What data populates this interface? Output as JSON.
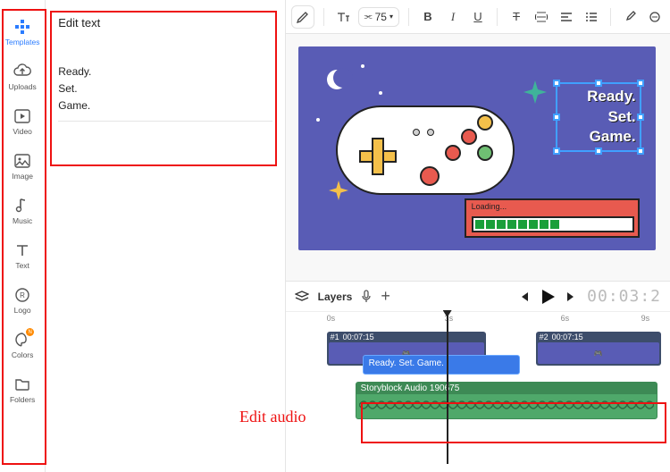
{
  "sidebar": {
    "items": [
      {
        "label": "Templates",
        "icon": "templates-icon"
      },
      {
        "label": "Uploads",
        "icon": "uploads-icon"
      },
      {
        "label": "Video",
        "icon": "video-icon"
      },
      {
        "label": "Image",
        "icon": "image-icon"
      },
      {
        "label": "Music",
        "icon": "music-icon"
      },
      {
        "label": "Text",
        "icon": "text-icon"
      },
      {
        "label": "Logo",
        "icon": "logo-icon"
      },
      {
        "label": "Colors",
        "icon": "colors-icon",
        "badge": "N"
      },
      {
        "label": "Folders",
        "icon": "folders-icon"
      }
    ]
  },
  "panel": {
    "title": "Edit text",
    "content": "Ready.\nSet.\nGame."
  },
  "toolbar": {
    "font_size": "75",
    "bold": "B",
    "italic": "I",
    "underline": "U",
    "strike": "T"
  },
  "canvas": {
    "loading_label": "Loading...",
    "overlay": {
      "l1": "Ready.",
      "l2": "Set.",
      "l3": "Game."
    }
  },
  "controls": {
    "layers_label": "Layers",
    "timecode": "00:03:2"
  },
  "timeline": {
    "ruler": [
      "0s",
      "3s",
      "6s",
      "9s"
    ],
    "clip1": {
      "index": "#1",
      "time": "00:07:15"
    },
    "clip2": {
      "index": "#2",
      "time": "00:07:15"
    },
    "text_clip": "Ready. Set. Game.",
    "audio_clip": "Storyblock Audio 190675"
  },
  "annotations": {
    "edit_audio": "Edit audio"
  }
}
